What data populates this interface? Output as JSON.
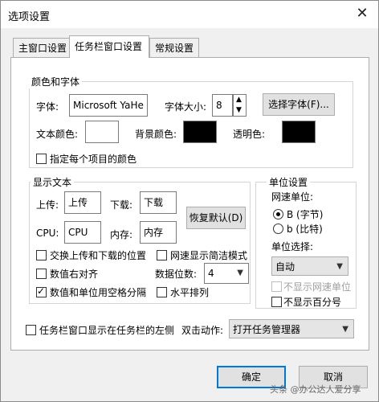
{
  "window": {
    "title": "选项设置",
    "close_glyph": "✕"
  },
  "tabs": [
    {
      "label": "主窗口设置"
    },
    {
      "label": "任务栏窗口设置"
    },
    {
      "label": "常规设置"
    }
  ],
  "color_font": {
    "legend": "颜色和字体",
    "font_label": "字体:",
    "font_value": "Microsoft YaHe",
    "font_size_label": "字体大小:",
    "font_size_value": "8",
    "choose_font_button": "选择字体(F)...",
    "text_color_label": "文本颜色:",
    "bg_color_label": "背景颜色:",
    "transparent_label": "透明色:",
    "text_color": "#ffffff",
    "bg_color": "#000000",
    "transparent_color": "#000000",
    "specify_each_color_label": "指定每个项目的颜色"
  },
  "display_text": {
    "legend": "显示文本",
    "upload_label": "上传:",
    "upload_value": "上传",
    "download_label": "下载:",
    "download_value": "下载",
    "cpu_label": "CPU:",
    "cpu_value": "CPU",
    "memory_label": "内存:",
    "memory_value": "内存",
    "restore_default_button": "恢复默认(D)"
  },
  "options": {
    "swap_upload_download": "交换上传和下载的位置",
    "net_simple_mode": "网速显示简洁模式",
    "value_right_align": "数值右对齐",
    "digits_label": "数据位数:",
    "digits_value": "4",
    "value_unit_space": "数值和单位用空格分隔",
    "horizontal_arrange": "水平排列"
  },
  "unit_settings": {
    "legend": "单位设置",
    "net_unit_label": "网速单位:",
    "byte_option": "B (字节)",
    "bit_option": "b (比特)",
    "unit_select_label": "单位选择:",
    "unit_select_value": "自动",
    "hide_net_unit": "不显示网速单位",
    "hide_percent": "不显示百分号"
  },
  "bottom": {
    "show_left_label": "任务栏窗口显示在任务栏的左侧",
    "double_click_label": "双击动作:",
    "double_click_value": "打开任务管理器",
    "ok_button": "确定",
    "cancel_button": "取消"
  },
  "watermark": "头条 @办公达人爱分享"
}
